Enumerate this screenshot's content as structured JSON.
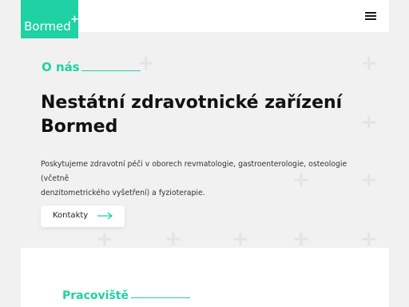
{
  "header": {
    "logo_text": "Bormed",
    "logo_plus": "+",
    "menu_icon": "hamburger-menu-icon"
  },
  "hero": {
    "eyebrow": "O nás",
    "title_line1": "Nestátní zdravotnické zařízení",
    "title_line2": "Bormed",
    "description_line1": "Poskytujeme zdravotní péči v oborech revmatologie, gastroenterologie, osteologie (včetně",
    "description_line2": "denzitometrického vyšetření) a fyzioterapie.",
    "button_label": "Kontakty",
    "button_icon": "arrow-right-icon"
  },
  "section": {
    "title": "Pracoviště"
  },
  "colors": {
    "accent": "#1fd1a3",
    "background": "#f1f1f1",
    "surface": "#ffffff",
    "text": "#111111"
  }
}
